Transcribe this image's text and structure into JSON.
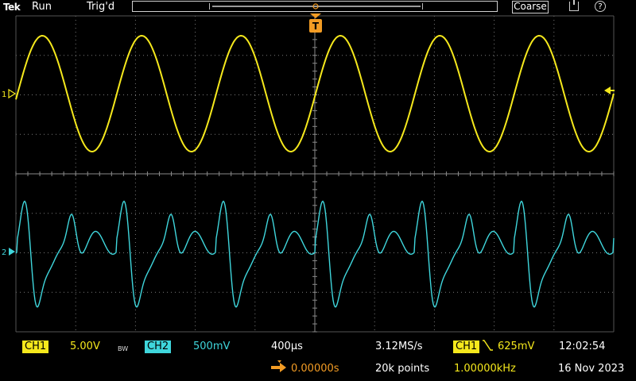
{
  "topbar": {
    "brand": "Tek",
    "run_state": "Run",
    "trigger_state": "Trig'd",
    "coarse_label": "Coarse"
  },
  "colors": {
    "ch1": "#f5e81c",
    "ch2": "#3fd6dc",
    "trigger": "#f39c24",
    "grid": "#7a7a7a"
  },
  "channel_markers": {
    "ch1": "1",
    "ch2": "2"
  },
  "trigger_marker": "T",
  "readouts": {
    "ch1_label": "CH1",
    "ch1_scale": "5.00V",
    "bw_limit": "BW",
    "ch2_label": "CH2",
    "ch2_scale": "500mV",
    "timebase": "400µs",
    "sample_rate": "3.12MS/s",
    "record_length": "20k points",
    "trigger_source": "CH1",
    "trigger_level": "625mV",
    "trigger_freq": "1.00000kHz",
    "trigger_delay": "0.00000s",
    "time": "12:02:54",
    "date": "16 Nov 2023"
  }
}
